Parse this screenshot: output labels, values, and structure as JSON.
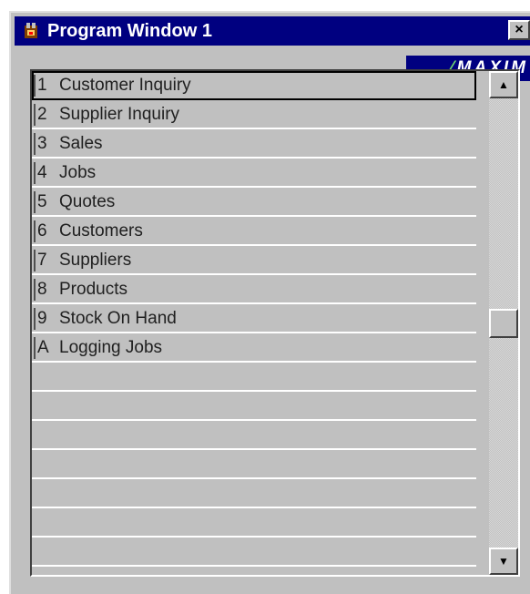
{
  "window": {
    "title": "Program Window 1",
    "close_label": "×",
    "logo_mark": "⁄",
    "logo_text": "MAXIM"
  },
  "menu": {
    "items": [
      {
        "key": "1",
        "label": "Customer Inquiry"
      },
      {
        "key": "2",
        "label": "Supplier Inquiry"
      },
      {
        "key": "3",
        "label": "Sales"
      },
      {
        "key": "4",
        "label": "Jobs"
      },
      {
        "key": "5",
        "label": "Quotes"
      },
      {
        "key": "6",
        "label": "Customers"
      },
      {
        "key": "7",
        "label": "Suppliers"
      },
      {
        "key": "8",
        "label": "Products"
      },
      {
        "key": "9",
        "label": "Stock On Hand"
      },
      {
        "key": "A",
        "label": "Logging Jobs"
      }
    ],
    "selected_index": 0,
    "empty_rows": 7
  },
  "scrollbar": {
    "up_icon": "▲",
    "down_icon": "▼",
    "position_fraction": 0.5
  },
  "colors": {
    "titlebar": "#000080",
    "face": "#c0c0c0",
    "logo_accent": "#6fdc6f"
  },
  "icons": {
    "app": "program-icon",
    "close": "close-icon",
    "scroll_up": "scroll-up-arrow-icon",
    "scroll_down": "scroll-down-arrow-icon"
  }
}
